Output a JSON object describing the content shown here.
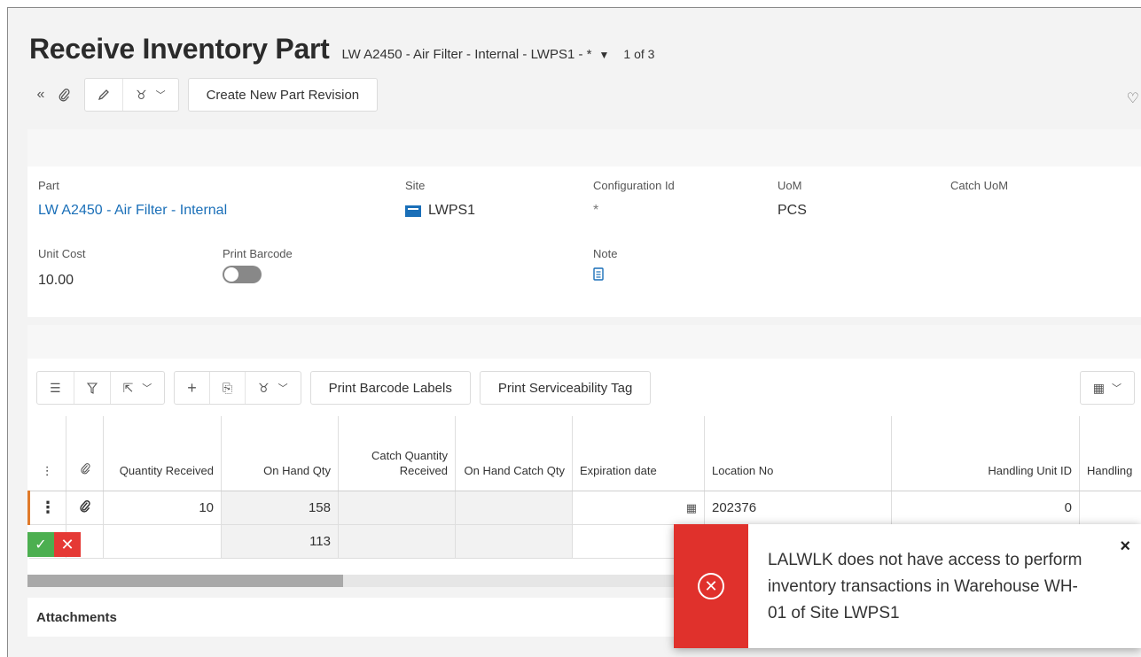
{
  "title": {
    "page": "Receive Inventory Part",
    "record": "LW A2450 - Air Filter - Internal - LWPS1 - *",
    "count": "1 of 3"
  },
  "toolbar": {
    "create_revision": "Create New Part Revision"
  },
  "header": {
    "part": {
      "label": "Part",
      "value": "LW A2450 - Air Filter - Internal"
    },
    "site": {
      "label": "Site",
      "value": "LWPS1"
    },
    "config": {
      "label": "Configuration Id",
      "value": "*"
    },
    "uom": {
      "label": "UoM",
      "value": "PCS"
    },
    "catch_uom": {
      "label": "Catch UoM",
      "value": ""
    },
    "unit_cost": {
      "label": "Unit Cost",
      "value": "10.00"
    },
    "print_barcode": {
      "label": "Print Barcode",
      "on": false
    },
    "note": {
      "label": "Note"
    }
  },
  "grid_toolbar": {
    "print_labels": "Print Barcode Labels",
    "print_tag": "Print Serviceability Tag"
  },
  "grid": {
    "columns": {
      "qty_received": "Quantity Received",
      "on_hand": "On Hand Qty",
      "catch_qty": "Catch Quantity Received",
      "on_hand_catch": "On Hand Catch Qty",
      "expiration": "Expiration date",
      "location": "Location No",
      "handling_unit": "Handling Unit ID",
      "handling": "Handling"
    },
    "rows": [
      {
        "qty_received": "10",
        "on_hand": "158",
        "catch_qty": "",
        "on_hand_catch": "",
        "location": "202376",
        "handling_unit": "0"
      },
      {
        "qty_received": "",
        "on_hand": "113",
        "catch_qty": "",
        "on_hand_catch": "",
        "location": "",
        "handling_unit": ""
      }
    ]
  },
  "attachments": {
    "label": "Attachments"
  },
  "toast": {
    "message": "LALWLK does not have access to perform inventory transactions in Warehouse WH-01 of Site LWPS1",
    "color": "#e0312c"
  }
}
